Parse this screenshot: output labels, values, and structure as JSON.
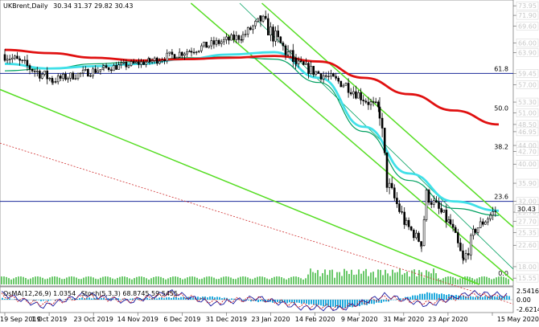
{
  "header": {
    "symbol": "UKBrent,Daily",
    "ohlc": "30.34 31.37 29.82 30.43"
  },
  "colors": {
    "candles": "#000000",
    "ma_red": "#e01010",
    "ma_cyan": "#40e0e8",
    "ma_green": "#00a060",
    "channel": "#55dd22",
    "horizontal": "#1a2a9a",
    "dotted_red": "#d03030",
    "volume": "#44bb44",
    "osma_hist": "#22aadd",
    "stoch_main": "#1a1aa0",
    "stoch_signal": "#d02020"
  },
  "chart_data": {
    "type": "candlestick",
    "symbol": "UKBrent",
    "timeframe": "Daily",
    "ylim": [
      14.2,
      74.5
    ],
    "right_axis_price_labels": [
      "73.95",
      "71.90",
      "69.60",
      "66.00",
      "63.90",
      "59.45",
      "57.00",
      "53.30",
      "51.00",
      "48.50",
      "46.95",
      "44.00",
      "42.70",
      "40.00",
      "35.90",
      "32.00",
      "29.70",
      "27.70",
      "25.35",
      "22.60",
      "18.00",
      "15.55"
    ],
    "current_price": "30.43",
    "fibonacci_levels": [
      {
        "label": "61.8",
        "price": 59.45
      },
      {
        "label": "50.0",
        "price": 51.0
      },
      {
        "label": "38.2",
        "price": 42.7
      },
      {
        "label": "23.6",
        "price": 32.0
      },
      {
        "label": "0.0",
        "price": 15.55
      }
    ],
    "horizontal_lines": [
      59.45,
      32.0
    ],
    "x_tick_labels": [
      "19 Sep 2019",
      "1 Oct 2019",
      "23 Oct 2019",
      "14 Nov 2019",
      "6 Dec 2019",
      "31 Dec 2019",
      "23 Jan 2020",
      "14 Feb 2020",
      "9 Mar 2020",
      "31 Mar 2020",
      "23 Apr 2020",
      "15 May 2020"
    ],
    "moving_averages": [
      {
        "color": "red",
        "approx_values": [
          64.5,
          63.8,
          62.8,
          62.2,
          62.5,
          62.8,
          63.2,
          62.0,
          58.5,
          55.0,
          51.5,
          48.5
        ]
      },
      {
        "color": "cyan",
        "approx_values": [
          61.5,
          60.5,
          61.0,
          61.5,
          62.5,
          63.5,
          64.0,
          58.5,
          48.0,
          38.0,
          32.0,
          30.0
        ]
      },
      {
        "color": "green",
        "approx_values": [
          60.0,
          60.5,
          61.5,
          62.0,
          62.8,
          63.0,
          62.5,
          57.5,
          47.0,
          36.5,
          30.5,
          29.0
        ]
      }
    ],
    "close_path": [
      {
        "x": "19 Sep 2019",
        "close": 63.5
      },
      {
        "x": "1 Oct 2019",
        "close": 58.0
      },
      {
        "x": "23 Oct 2019",
        "close": 60.5
      },
      {
        "x": "14 Nov 2019",
        "close": 62.0
      },
      {
        "x": "6 Dec 2019",
        "close": 64.5
      },
      {
        "x": "31 Dec 2019",
        "close": 67.5
      },
      {
        "x": "8 Jan 2020",
        "close": 71.0
      },
      {
        "x": "23 Jan 2020",
        "close": 61.5
      },
      {
        "x": "14 Feb 2020",
        "close": 57.0
      },
      {
        "x": "2 Mar 2020",
        "close": 51.5
      },
      {
        "x": "9 Mar 2020",
        "close": 36.0
      },
      {
        "x": "20 Mar 2020",
        "close": 27.0
      },
      {
        "x": "31 Mar 2020",
        "close": 23.0
      },
      {
        "x": "3 Apr 2020",
        "close": 33.5
      },
      {
        "x": "15 Apr 2020",
        "close": 27.0
      },
      {
        "x": "22 Apr 2020",
        "close": 19.0
      },
      {
        "x": "30 Apr 2020",
        "close": 26.0
      },
      {
        "x": "15 May 2020",
        "close": 30.4
      }
    ],
    "oscillator": {
      "osma_label": "OsMA(12,26,9) 1.0354",
      "stoch_label": "Stoch(5,3,3) 68.8745 59.5455",
      "axis_labels": [
        "2.5416",
        "0.00",
        "-2.6214"
      ],
      "osma_approx": [
        0.4,
        -0.3,
        0.5,
        0.2,
        0.6,
        0.8,
        -0.5,
        -0.9,
        -2.3,
        -0.6,
        1.9,
        0.8,
        1.0
      ],
      "stoch_main_approx": [
        80,
        20,
        75,
        40,
        85,
        30,
        60,
        15,
        10,
        70,
        25,
        80,
        69
      ],
      "stoch_signal_approx": [
        70,
        30,
        65,
        45,
        75,
        40,
        55,
        25,
        15,
        60,
        35,
        70,
        60
      ]
    }
  }
}
